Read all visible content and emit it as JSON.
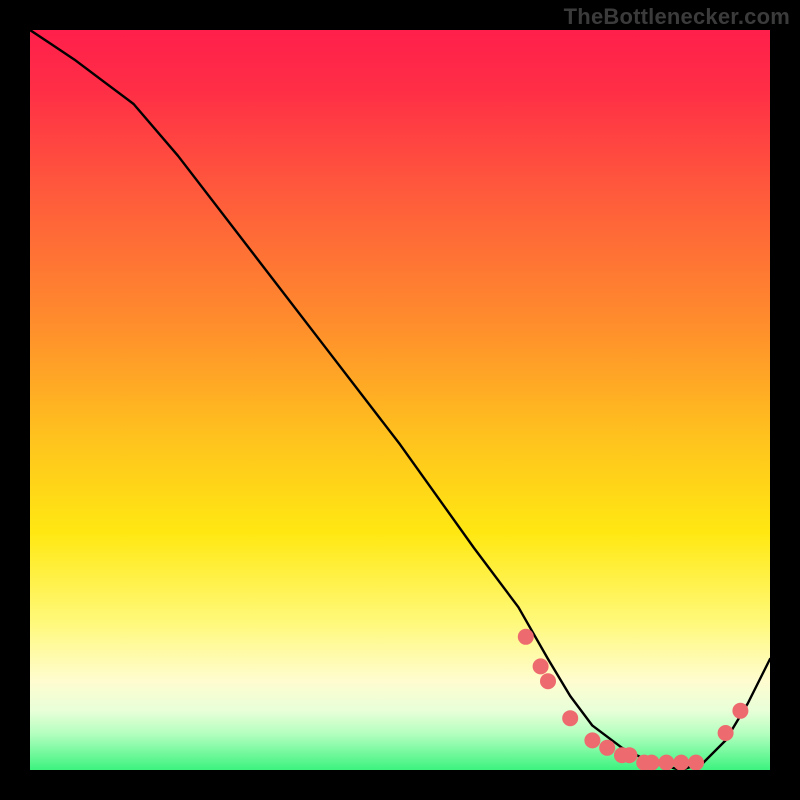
{
  "watermark": "TheBottlenecker.com",
  "chart_data": {
    "type": "line",
    "title": "",
    "xlabel": "",
    "ylabel": "",
    "xlim": [
      0,
      100
    ],
    "ylim": [
      0,
      100
    ],
    "series": [
      {
        "name": "curve",
        "x": [
          0,
          3,
          6,
          10,
          14,
          20,
          30,
          40,
          50,
          60,
          66,
          70,
          73,
          76,
          80,
          84,
          88,
          91,
          94,
          97,
          100
        ],
        "y": [
          100,
          98,
          96,
          93,
          90,
          83,
          70,
          57,
          44,
          30,
          22,
          15,
          10,
          6,
          3,
          1,
          0,
          1,
          4,
          9,
          15
        ]
      }
    ],
    "markers": [
      {
        "x": 67,
        "y": 18,
        "color": "#ed6a6e"
      },
      {
        "x": 69,
        "y": 14,
        "color": "#ed6a6e"
      },
      {
        "x": 70,
        "y": 12,
        "color": "#ed6a6e"
      },
      {
        "x": 73,
        "y": 7,
        "color": "#ed6a6e"
      },
      {
        "x": 76,
        "y": 4,
        "color": "#ed6a6e"
      },
      {
        "x": 78,
        "y": 3,
        "color": "#ed6a6e"
      },
      {
        "x": 80,
        "y": 2,
        "color": "#ed6a6e"
      },
      {
        "x": 81,
        "y": 2,
        "color": "#ed6a6e"
      },
      {
        "x": 83,
        "y": 1,
        "color": "#ed6a6e"
      },
      {
        "x": 84,
        "y": 1,
        "color": "#ed6a6e"
      },
      {
        "x": 86,
        "y": 1,
        "color": "#ed6a6e"
      },
      {
        "x": 88,
        "y": 1,
        "color": "#ed6a6e"
      },
      {
        "x": 90,
        "y": 1,
        "color": "#ed6a6e"
      },
      {
        "x": 94,
        "y": 5,
        "color": "#ed6a6e"
      },
      {
        "x": 96,
        "y": 8,
        "color": "#ed6a6e"
      }
    ],
    "gradient_stops": [
      {
        "pos": 0,
        "color": "#ff1f4b"
      },
      {
        "pos": 8,
        "color": "#ff2e46"
      },
      {
        "pos": 22,
        "color": "#ff5a3c"
      },
      {
        "pos": 40,
        "color": "#ff8e2c"
      },
      {
        "pos": 55,
        "color": "#ffc21e"
      },
      {
        "pos": 68,
        "color": "#ffe812"
      },
      {
        "pos": 80,
        "color": "#fff97a"
      },
      {
        "pos": 88,
        "color": "#fffcd0"
      },
      {
        "pos": 92,
        "color": "#e8ffd8"
      },
      {
        "pos": 95,
        "color": "#b6ffc0"
      },
      {
        "pos": 100,
        "color": "#3cf37f"
      }
    ]
  }
}
